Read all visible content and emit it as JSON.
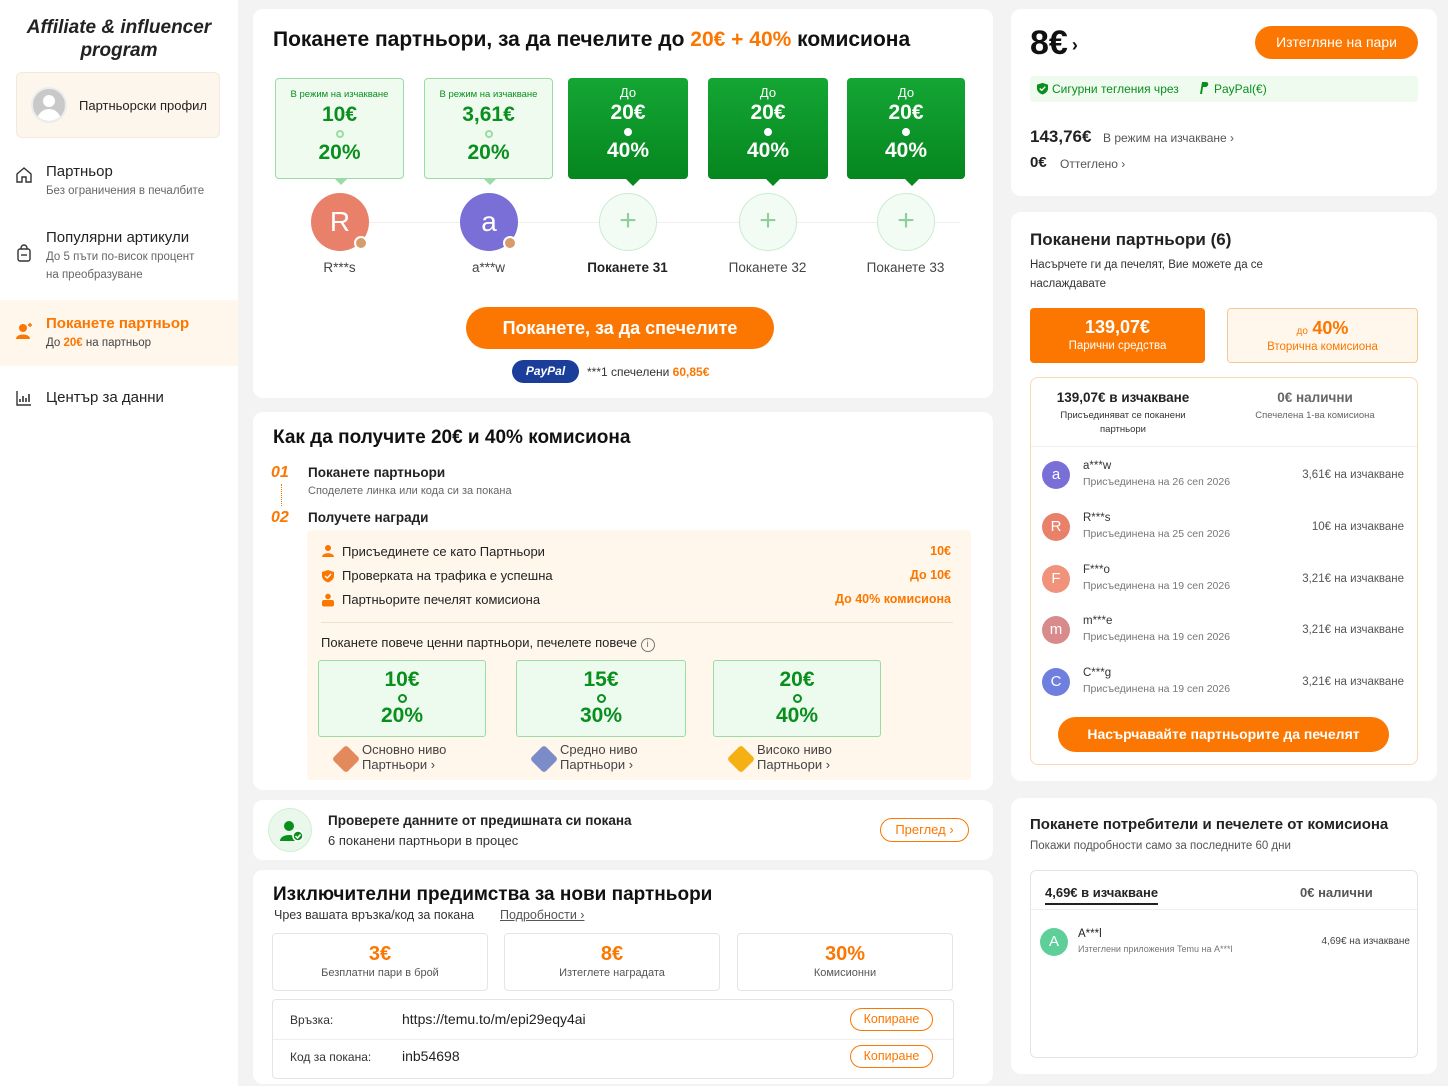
{
  "sidebar": {
    "logo_line1": "Affiliate & influencer",
    "logo_line2": "program",
    "profile_label": "Партньорски профил",
    "items": [
      {
        "title": "Партньор",
        "sub": "Без ограничения в печалбите"
      },
      {
        "title": "Популярни артикули",
        "sub1": "До 5 пъти по-висок процент",
        "sub2": "на преобразуване"
      },
      {
        "title": "Поканете партньор",
        "sub_pre": "До ",
        "sub_amount": "20€",
        "sub_post": " на партньор"
      },
      {
        "title": "Център за данни"
      }
    ]
  },
  "invite": {
    "title_pre": "Поканете партньори, за да печелите до ",
    "title_highlight": "20€ + 40%",
    "title_post": " комисиона",
    "slots": [
      {
        "label": "В режим на изчакване",
        "v1": "10€",
        "v2": "20%",
        "name": "R***s",
        "initial": "R",
        "color": "#e8806a"
      },
      {
        "label": "В режим на изчакване",
        "v1": "3,61€",
        "v2": "20%",
        "name": "a***w",
        "initial": "a",
        "color": "#7a6fd6"
      },
      {
        "label": "До",
        "v1": "20€",
        "v2": "40%",
        "name": "Поканете 31"
      },
      {
        "label": "До",
        "v1": "20€",
        "v2": "40%",
        "name": "Поканете 32"
      },
      {
        "label": "До",
        "v1": "20€",
        "v2": "40%",
        "name": "Поканете 33"
      }
    ],
    "cta": "Поканете, за да спечелите",
    "paypal": "PayPal",
    "ticker_user": "***1 спечелени ",
    "ticker_amount": "60,85€"
  },
  "how": {
    "title": "Как да получите 20€ и 40% комисиона",
    "step1_num": "01",
    "step1_title": "Поканете партньори",
    "step1_sub": "Споделете линка или кода си за покана",
    "step2_num": "02",
    "step2_title": "Получете награди",
    "rewards": [
      {
        "label": "Присъединете се като Партньори",
        "value": "10€"
      },
      {
        "label": "Проверката на трафика е успешна",
        "value": "До 10€"
      },
      {
        "label": "Партньорите печелят комисиона",
        "value": "До 40% комисиона"
      }
    ],
    "more_text": "Поканете повече ценни партньори, печелете повече",
    "levels": [
      {
        "a": "10€",
        "b": "20%",
        "name1": "Основно ниво",
        "name2": "Партньори ›",
        "badge": "#e38a5c"
      },
      {
        "a": "15€",
        "b": "30%",
        "name1": "Средно ниво",
        "name2": "Партньори ›",
        "badge": "#7b8cc9"
      },
      {
        "a": "20€",
        "b": "40%",
        "name1": "Високо ниво",
        "name2": "Партньори ›",
        "badge": "#f5b013"
      }
    ]
  },
  "check": {
    "title": "Проверете данните от предишната си покана",
    "sub": "6 поканени партньори в процес",
    "button": "Преглед ›"
  },
  "exclusive": {
    "title": "Изключителни предимства за нови партньори",
    "sub": "Чрез вашата връзка/код за покана",
    "details": "Подробности ›",
    "benefits": [
      {
        "value": "3€",
        "caption": "Безплатни пари в брой"
      },
      {
        "value": "8€",
        "caption": "Изтеглете наградата"
      },
      {
        "value": "30%",
        "caption": "Комисионни"
      }
    ],
    "link_label": "Връзка:",
    "link_value": "https://temu.to/m/epi29eqy4ai",
    "code_label": "Код за покана:",
    "code_value": "inb54698",
    "copy": "Копиране"
  },
  "balance": {
    "amount": "8€",
    "withdraw": "Изтегляне на пари",
    "secure": "Сигурни тегления чрез",
    "paypal": "PayPal(€)",
    "pending_amount": "143,76€",
    "pending_label": "В режим на изчакване ›",
    "withdrawn_amount": "0€",
    "withdrawn_label": "Оттеглено ›"
  },
  "invited": {
    "title": "Поканени партньори (6)",
    "sub1": "Насърчете ги да печелят, Вие можете да се",
    "sub2": "наслаждавате",
    "tab1_value": "139,07€",
    "tab1_label": "Парични средства",
    "tab2_prefix": "до",
    "tab2_value": "40%",
    "tab2_label": "Вторична комисиона",
    "pending_head": "139,07€ в изчакване",
    "pending_sub1": "Присъединяват се поканени",
    "pending_sub2": "партньори",
    "avail_head": "0€ налични",
    "avail_sub": "Спечелена 1-ва комисиона",
    "rows": [
      {
        "initial": "a",
        "name": "a***w",
        "date": "Присъединена на 26 сеп 2026",
        "status": "3,61€ на изчакване",
        "color": "#7a6fd6"
      },
      {
        "initial": "R",
        "name": "R***s",
        "date": "Присъединена на 25 сеп 2026",
        "status": "10€ на изчакване",
        "color": "#e8806a"
      },
      {
        "initial": "F",
        "name": "F***o",
        "date": "Присъединена на 19 сеп 2026",
        "status": "3,21€ на изчакване",
        "color": "#f0937a"
      },
      {
        "initial": "m",
        "name": "m***e",
        "date": "Присъединена на 19 сеп 2026",
        "status": "3,21€ на изчакване",
        "color": "#d98a8a"
      },
      {
        "initial": "C",
        "name": "C***g",
        "date": "Присъединена на 19 сеп 2026",
        "status": "3,21€ на изчакване",
        "color": "#6f7fe0"
      }
    ],
    "encourage": "Насърчавайте партньорите да печелят"
  },
  "consumers": {
    "title": "Поканете потребители и печелете от комисиона",
    "sub": "Покажи подробности само за последните 60 дни",
    "tab1": "4,69€ в изчакване",
    "tab2": "0€ налични",
    "row_initial": "A",
    "row_name": "A***l",
    "row_desc": "Изтеглени приложения Temu на A***l",
    "row_status": "4,69€ на изчакване"
  }
}
